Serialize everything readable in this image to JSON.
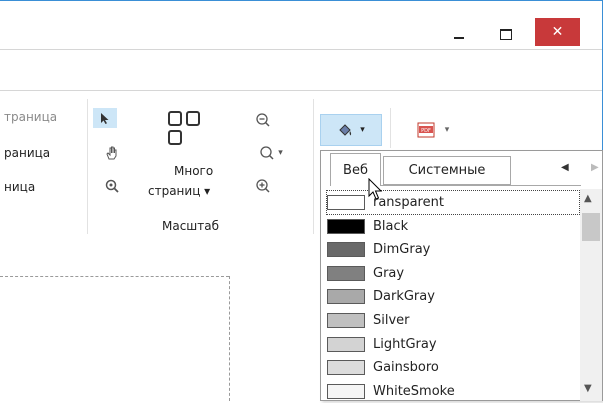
{
  "window": {
    "minimize_glyph": "—",
    "maximize_glyph": "☐",
    "close_glyph": "✕"
  },
  "ribbon": {
    "page_group": {
      "items": [
        "траница",
        "раница",
        "ница"
      ]
    },
    "multi_page": {
      "label_line1": "Много",
      "label_line2": "страниц ▾"
    },
    "zoom_group_label": "Масштаб"
  },
  "color_dropdown": {
    "tabs": [
      "Веб",
      "Системные"
    ],
    "active_tab": "Веб",
    "colors": [
      {
        "name": "Transparent",
        "hex": "#ffffff",
        "display": "ransparent"
      },
      {
        "name": "Black",
        "hex": "#000000",
        "display": "Black"
      },
      {
        "name": "DimGray",
        "hex": "#696969",
        "display": "DimGray"
      },
      {
        "name": "Gray",
        "hex": "#808080",
        "display": "Gray"
      },
      {
        "name": "DarkGray",
        "hex": "#a9a9a9",
        "display": "DarkGray"
      },
      {
        "name": "Silver",
        "hex": "#c0c0c0",
        "display": "Silver"
      },
      {
        "name": "LightGray",
        "hex": "#d3d3d3",
        "display": "LightGray"
      },
      {
        "name": "Gainsboro",
        "hex": "#dcdcdc",
        "display": "Gainsboro"
      },
      {
        "name": "WhiteSmoke",
        "hex": "#f5f5f5",
        "display": "WhiteSmoke"
      }
    ]
  }
}
